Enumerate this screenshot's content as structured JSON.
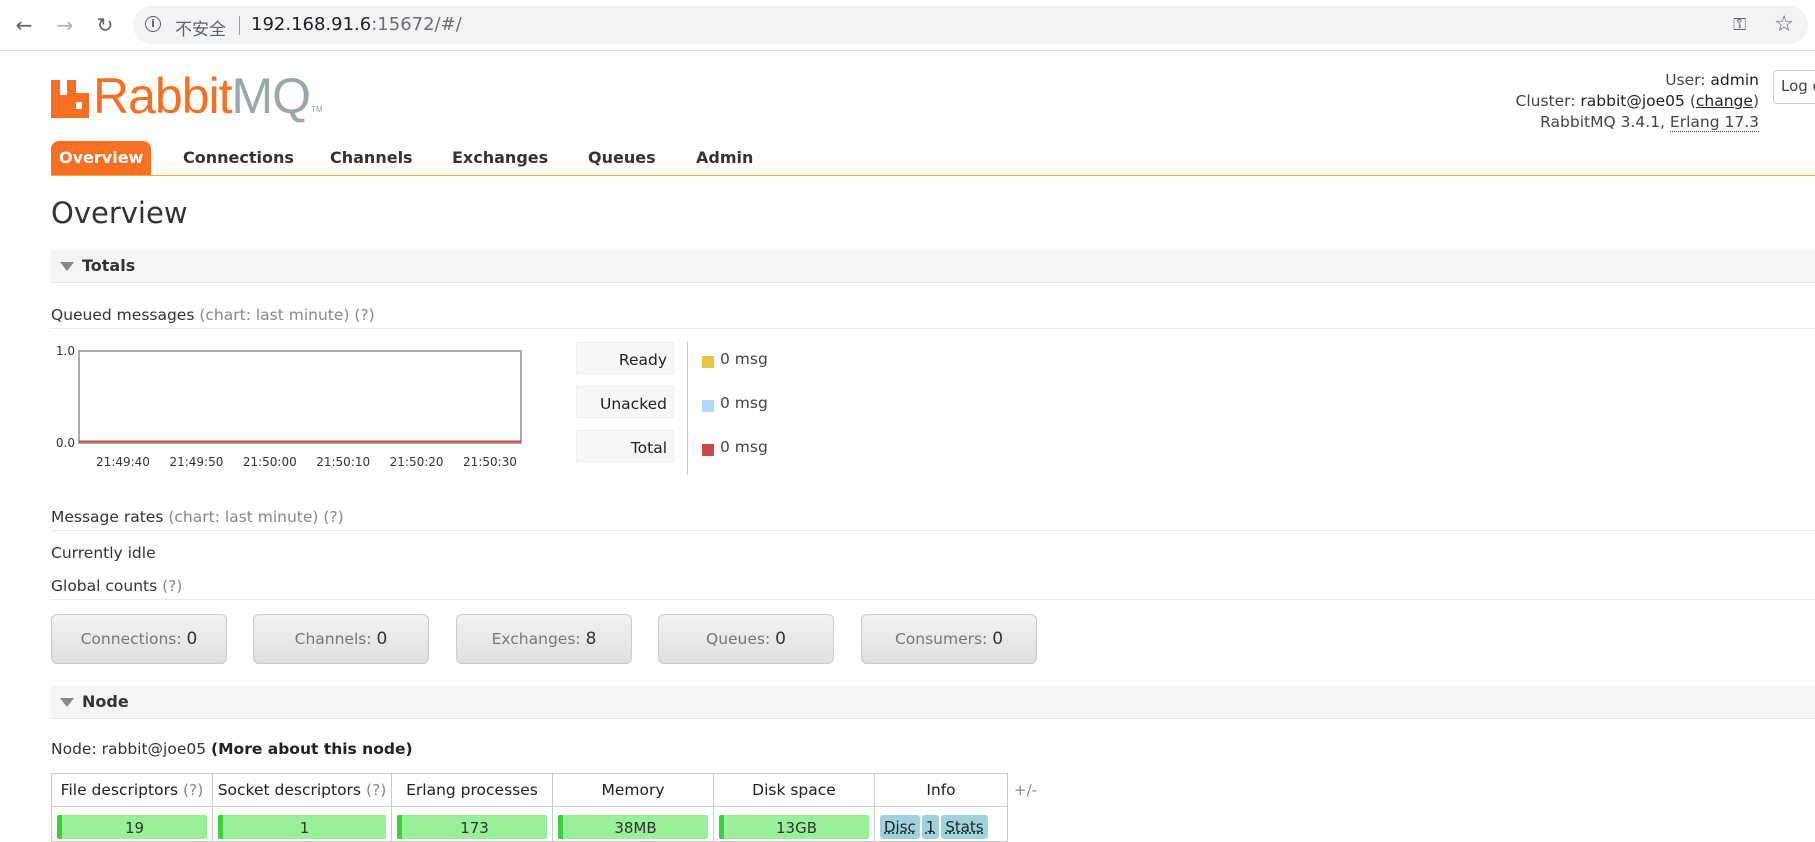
{
  "browser": {
    "back_icon": "arrow-left-icon",
    "forward_icon": "arrow-right-icon",
    "reload_icon": "reload-icon",
    "insecure_label": "不安全",
    "url_host": "192.168.91.6",
    "url_rest": ":15672/#/",
    "key_icon": "key-icon",
    "star_icon": "star-icon"
  },
  "logo": {
    "rabbit": "Rabbit",
    "mq": "MQ",
    "tm": "TM"
  },
  "header": {
    "user_label": "User:",
    "user_value": "admin",
    "cluster_label": "Cluster:",
    "cluster_value": "rabbit@joe05",
    "change_link": "change",
    "version": "RabbitMQ 3.4.1,",
    "erlang": "Erlang 17.3",
    "logout_label": "Log out"
  },
  "tabs": [
    "Overview",
    "Connections",
    "Channels",
    "Exchanges",
    "Queues",
    "Admin"
  ],
  "page_title": "Overview",
  "totals": {
    "section_label": "Totals",
    "queued_title": "Queued messages",
    "queued_note": "(chart: last minute) (?)",
    "rates_title": "Message rates",
    "rates_note": "(chart: last minute) (?)",
    "idle_text": "Currently idle",
    "global_title": "Global counts",
    "global_note": "(?)"
  },
  "chart_data": {
    "type": "line",
    "x": [
      "21:49:40",
      "21:49:50",
      "21:50:00",
      "21:50:10",
      "21:50:20",
      "21:50:30"
    ],
    "y_ticks": [
      "0.0",
      "1.0"
    ],
    "ylim": [
      0,
      1
    ],
    "series": [
      {
        "name": "Ready",
        "color": "#edc240",
        "values": [
          0,
          0,
          0,
          0,
          0,
          0
        ]
      },
      {
        "name": "Unacked",
        "color": "#afd8f8",
        "values": [
          0,
          0,
          0,
          0,
          0,
          0
        ]
      },
      {
        "name": "Total",
        "color": "#cb4b4b",
        "values": [
          0,
          0,
          0,
          0,
          0,
          0
        ]
      }
    ]
  },
  "legend": [
    {
      "label": "Ready",
      "value": "0 msg",
      "color": "#edc240"
    },
    {
      "label": "Unacked",
      "value": "0 msg",
      "color": "#afd8f8"
    },
    {
      "label": "Total",
      "value": "0 msg",
      "color": "#cb4b4b"
    }
  ],
  "counts": [
    {
      "label": "Connections:",
      "value": "0"
    },
    {
      "label": "Channels:",
      "value": "0"
    },
    {
      "label": "Exchanges:",
      "value": "8"
    },
    {
      "label": "Queues:",
      "value": "0"
    },
    {
      "label": "Consumers:",
      "value": "0"
    }
  ],
  "node": {
    "section_label": "Node",
    "node_label": "Node:",
    "node_value": "rabbit@joe05",
    "more_link": "(More about this node)",
    "columns": [
      {
        "label": "File descriptors",
        "help": "(?)"
      },
      {
        "label": "Socket descriptors",
        "help": "(?)"
      },
      {
        "label": "Erlang processes",
        "help": ""
      },
      {
        "label": "Memory",
        "help": ""
      },
      {
        "label": "Disk space",
        "help": ""
      },
      {
        "label": "Info",
        "help": ""
      }
    ],
    "values": [
      "19",
      "1",
      "173",
      "38MB",
      "13GB"
    ],
    "info_tags": [
      "Disc",
      "1",
      "Stats"
    ],
    "plus_minus": "+/-"
  }
}
